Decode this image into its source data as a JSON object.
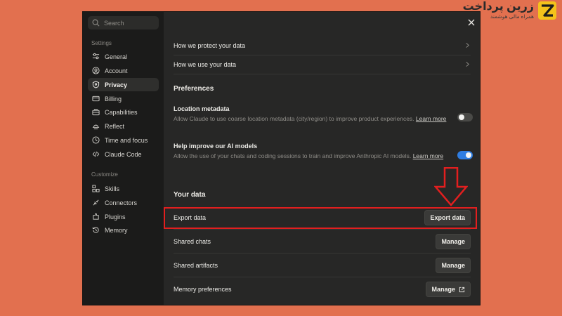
{
  "logo": {
    "title": "زرین پرداخت",
    "subtitle": "همراه مالی هوشمند"
  },
  "search": {
    "placeholder": "Search"
  },
  "sidebar": {
    "settings_label": "Settings",
    "items": [
      {
        "label": "General",
        "icon": "sliders-icon"
      },
      {
        "label": "Account",
        "icon": "user-circle-icon"
      },
      {
        "label": "Privacy",
        "icon": "shield-icon",
        "active": true
      },
      {
        "label": "Billing",
        "icon": "credit-card-icon"
      },
      {
        "label": "Capabilities",
        "icon": "briefcase-icon"
      },
      {
        "label": "Reflect",
        "icon": "sunset-icon"
      },
      {
        "label": "Time and focus",
        "icon": "clock-icon"
      },
      {
        "label": "Claude Code",
        "icon": "code-icon"
      }
    ],
    "customize_label": "Customize",
    "custom_items": [
      {
        "label": "Skills",
        "icon": "blocks-icon"
      },
      {
        "label": "Connectors",
        "icon": "connector-icon"
      },
      {
        "label": "Plugins",
        "icon": "plugin-icon"
      },
      {
        "label": "Memory",
        "icon": "history-icon"
      }
    ]
  },
  "main": {
    "links": [
      {
        "label": "How we protect your data"
      },
      {
        "label": "How we use your data"
      }
    ],
    "preferences_heading": "Preferences",
    "location": {
      "title": "Location metadata",
      "desc": "Allow Claude to use coarse location metadata (city/region) to improve product experiences.",
      "learn": "Learn more",
      "enabled": false
    },
    "improve": {
      "title": "Help improve our AI models",
      "desc": "Allow the use of your chats and coding sessions to train and improve Anthropic AI models.",
      "learn": "Learn more",
      "enabled": true
    },
    "your_data_heading": "Your data",
    "data_rows": [
      {
        "label": "Export data",
        "button": "Export data"
      },
      {
        "label": "Shared chats",
        "button": "Manage"
      },
      {
        "label": "Shared artifacts",
        "button": "Manage"
      },
      {
        "label": "Memory preferences",
        "button": "Manage"
      }
    ]
  }
}
